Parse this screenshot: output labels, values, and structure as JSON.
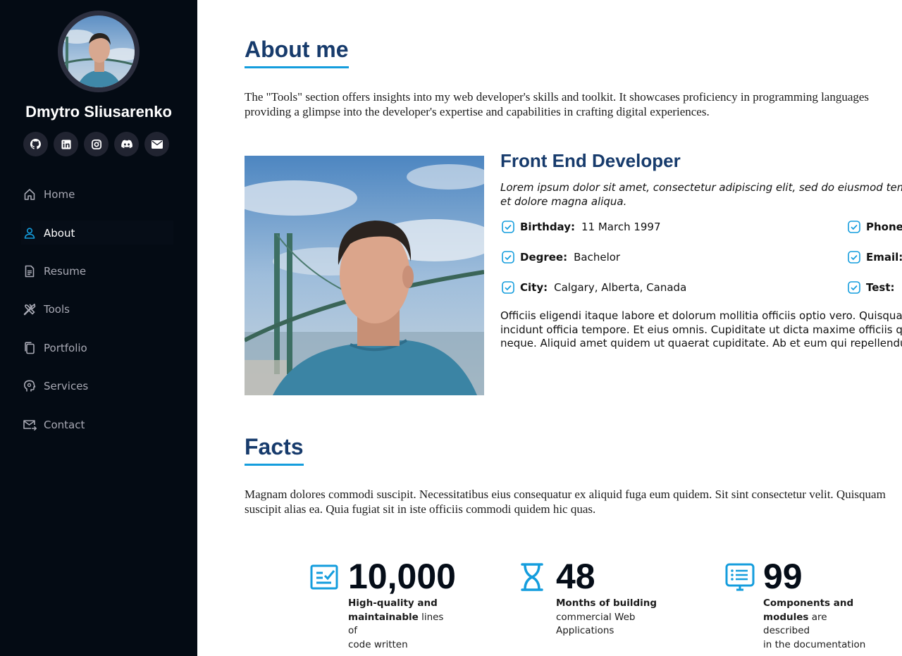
{
  "profile": {
    "name": "Dmytro Sliusarenko"
  },
  "socials": [
    {
      "icon": "github-icon"
    },
    {
      "icon": "linkedin-icon"
    },
    {
      "icon": "instagram-icon"
    },
    {
      "icon": "discord-icon"
    },
    {
      "icon": "email-icon"
    }
  ],
  "nav": [
    {
      "label": "Home",
      "icon": "home-icon"
    },
    {
      "label": "About",
      "icon": "user-icon",
      "active": true
    },
    {
      "label": "Resume",
      "icon": "file-icon"
    },
    {
      "label": "Tools",
      "icon": "tools-icon"
    },
    {
      "label": "Portfolio",
      "icon": "files-icon"
    },
    {
      "label": "Services",
      "icon": "services-icon"
    },
    {
      "label": "Contact",
      "icon": "envelope-icon"
    }
  ],
  "about": {
    "title": "About me",
    "intro_line1": "The \"Tools\" section offers insights into my web developer's skills and toolkit. It showcases proficiency in programming languages",
    "intro_line2": "providing a glimpse into the developer's expertise and capabilities in crafting digital experiences."
  },
  "role": {
    "title": "Front End Developer",
    "desc_line1": "Lorem ipsum dolor sit amet, consectetur adipiscing elit, sed do eiusmod tempor",
    "desc_line2": "et dolore magna aliqua."
  },
  "info": {
    "birthday_label": "Birthday:",
    "birthday_value": "11 March 1997",
    "degree_label": "Degree:",
    "degree_value": "Bachelor",
    "city_label": "City:",
    "city_value": "Calgary, Alberta, Canada",
    "phone_label": "Phone:",
    "email_label": "Email:",
    "test_label": "Test:"
  },
  "body_text": {
    "line1": "Officiis eligendi itaque labore et dolorum mollitia officiis optio vero. Quisquam sunt",
    "line2": "incidunt officia tempore. Et eius omnis. Cupiditate ut dicta maxime officiis quidem",
    "line3": "neque. Aliquid amet quidem ut quaerat cupiditate. Ab et eum qui repellendus omnis"
  },
  "facts": {
    "title": "Facts",
    "intro_line1": "Magnam dolores commodi suscipit. Necessitatibus eius consequatur ex aliquid fuga eum quidem. Sit sint consectetur velit. Quisquam",
    "intro_line2": "suscipit alias ea. Quia fugiat sit in iste officiis commodi quidem hic quas.",
    "items": [
      {
        "icon": "checklist-icon",
        "number": "10,000",
        "bold1": "High-quality and",
        "bold2": "maintainable",
        "rest2": " lines of",
        "line3": "code written"
      },
      {
        "icon": "hourglass-icon",
        "number": "48",
        "bold1": "Months of building",
        "line2": "commercial Web",
        "line3": "Applications"
      },
      {
        "icon": "list-screen-icon",
        "number": "99",
        "bold1": "Components and",
        "bold2": "modules",
        "rest2": " are described",
        "line3": "in the documentation"
      }
    ]
  },
  "colors": {
    "sidebar_bg": "#040b14",
    "accent": "#149ddd",
    "heading": "#173b6c"
  }
}
